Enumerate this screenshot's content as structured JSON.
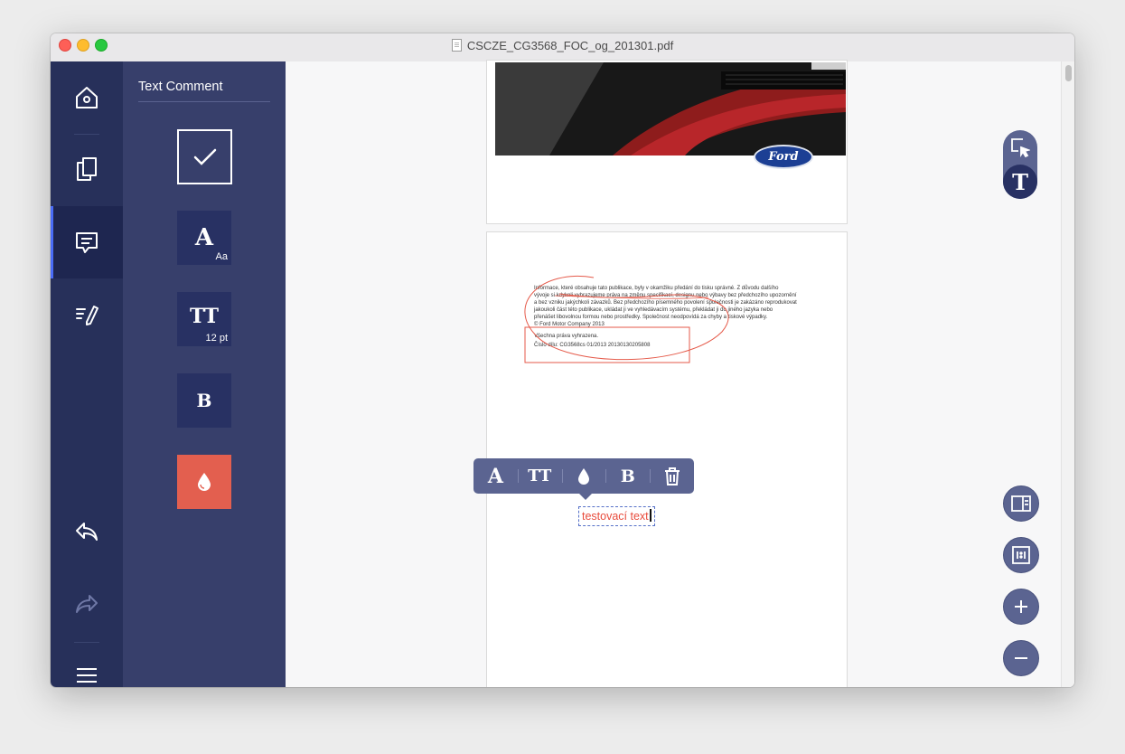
{
  "window": {
    "title": "CSCZE_CG3568_FOC_og_201301.pdf"
  },
  "rail": {
    "items": [
      {
        "name": "home",
        "icon": "home-icon"
      },
      {
        "name": "pages",
        "icon": "pages-icon"
      },
      {
        "name": "comment",
        "icon": "comment-icon",
        "active": true
      },
      {
        "name": "edit",
        "icon": "edit-icon"
      },
      {
        "name": "undo",
        "icon": "undo-icon"
      },
      {
        "name": "redo",
        "icon": "redo-icon"
      },
      {
        "name": "menu",
        "icon": "menu-icon"
      }
    ]
  },
  "panel": {
    "title": "Text Comment",
    "tools": {
      "confirm": {
        "icon": "checkmark-icon"
      },
      "font": {
        "label": "A",
        "sub": "Aa"
      },
      "size": {
        "label": "TT",
        "sub": "12 pt"
      },
      "bold": {
        "label": "B"
      },
      "color": {
        "icon": "drop-icon",
        "value": "#e35f4f"
      }
    }
  },
  "document": {
    "logo_text": "Ford",
    "page2_text": [
      "Informace, které obsahuje tato publikace, byly v okamžiku předání do tisku správné. Z důvodu dalšího",
      "vývoje si kdykoli vyhrazujeme práva na změnu specifikací, designu nebo výbavy bez předchozího upozornění",
      "a bez vzniku jakýchkoli závazků. Bez předchozího písemného povolení společnosti je zakázáno reprodukovat",
      "jakoukoli část této publikace, ukládat ji ve vyhledávacím systému, překládat ji do jiného jazyka nebo",
      "přenášet libovolnou formou nebo prostředky. Společnost neodpovídá za chyby a tiskové výpadky.",
      "© Ford Motor Company 2013"
    ],
    "rights": "Všechna práva vyhrazena.",
    "doc_number": "Číslo dílu: CG3568cs 01/2013 20130130205808",
    "comment_text": "testovací text"
  },
  "popover": {
    "items": [
      {
        "name": "font",
        "label": "A"
      },
      {
        "name": "size",
        "label": "TT"
      },
      {
        "name": "color",
        "icon": "drop-icon"
      },
      {
        "name": "bold",
        "label": "B"
      },
      {
        "name": "delete",
        "icon": "trash-icon"
      }
    ]
  },
  "right_tools": {
    "mode_select": "select-icon",
    "mode_text": "text-icon",
    "layout": "panel-layout-icon",
    "actual_size": "actual-size-icon",
    "zoom_in": "+",
    "zoom_out": "−"
  },
  "colors": {
    "rail": "#27305a",
    "panel": "#373f6b",
    "accent": "#4a6cf7",
    "annotation": "#e84b3c",
    "fab": "#5b6491"
  }
}
